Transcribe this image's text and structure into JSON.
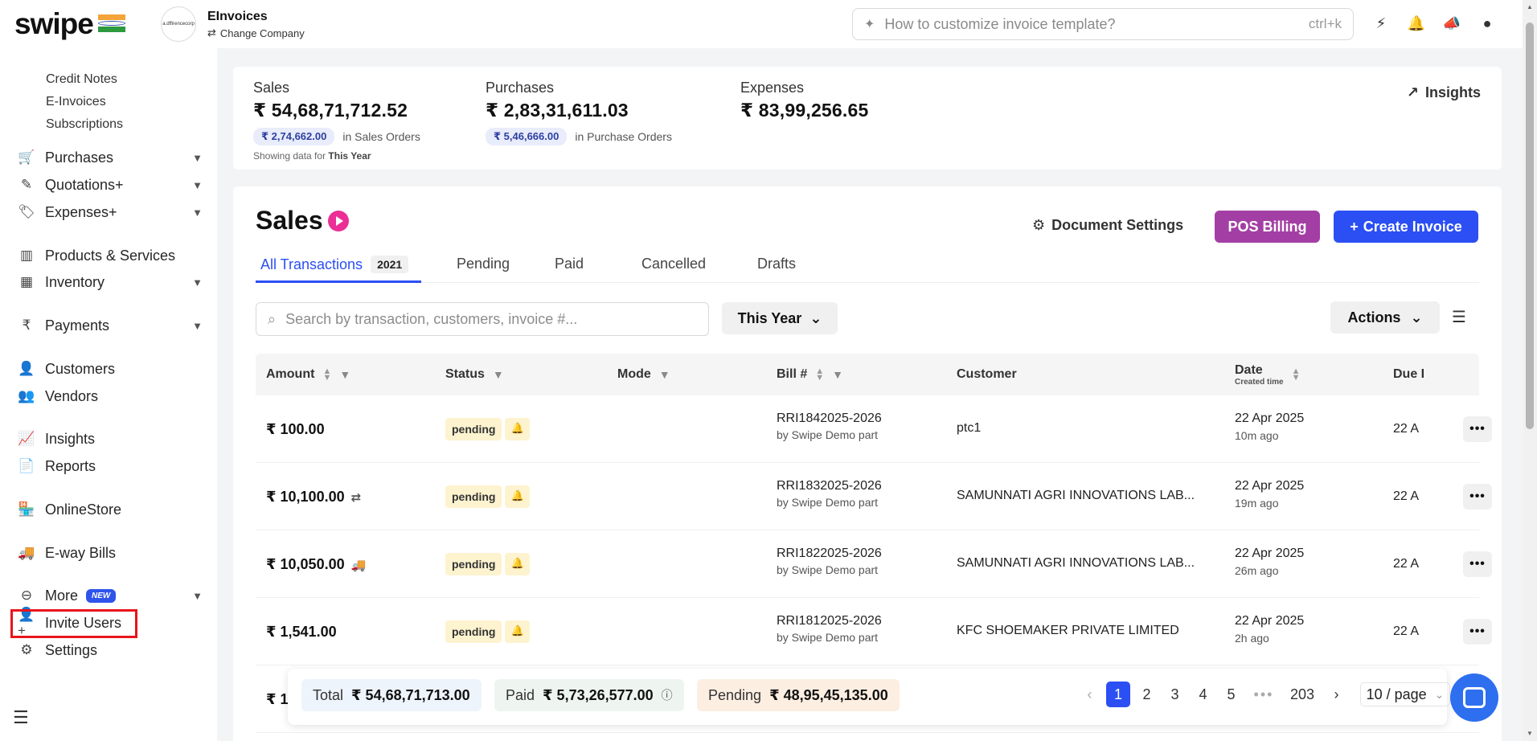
{
  "brand": {
    "logo_text": "swipe"
  },
  "company": {
    "avatar_text": "a.dffirencecorp",
    "name": "EInvoices",
    "change_label": "Change Company"
  },
  "topbar": {
    "search_placeholder": "How to customize invoice template?",
    "shortcut": "ctrl+k"
  },
  "sidebar": {
    "sub_items": [
      "Credit Notes",
      "E-Invoices",
      "Subscriptions"
    ],
    "items": {
      "purchases": "Purchases",
      "quotations": "Quotations+",
      "expenses": "Expenses+",
      "products": "Products & Services",
      "inventory": "Inventory",
      "payments": "Payments",
      "customers": "Customers",
      "vendors": "Vendors",
      "insights": "Insights",
      "reports": "Reports",
      "onlinestore": "OnlineStore",
      "ewaybills": "E-way Bills",
      "more": "More",
      "more_badge": "NEW",
      "invite": "Invite Users",
      "settings": "Settings"
    }
  },
  "stats": {
    "sales": {
      "label": "Sales",
      "value": "₹ 54,68,71,712.52",
      "pill": "₹ 2,74,662.00",
      "pill_note": "in Sales Orders"
    },
    "purchases": {
      "label": "Purchases",
      "value": "₹ 2,83,31,611.03",
      "pill": "₹ 5,46,666.00",
      "pill_note": "in Purchase Orders"
    },
    "expenses": {
      "label": "Expenses",
      "value": "₹ 83,99,256.65"
    },
    "showing_prefix": "Showing data for",
    "showing_period": "This Year",
    "insights_label": "Insights"
  },
  "page": {
    "title": "Sales",
    "doc_settings": "Document Settings",
    "pos_billing": "POS Billing",
    "create_invoice": "Create Invoice",
    "tabs": {
      "all": "All Transactions",
      "all_count": "2021",
      "pending": "Pending",
      "paid": "Paid",
      "cancelled": "Cancelled",
      "drafts": "Drafts"
    },
    "search_placeholder": "Search by transaction, customers, invoice #...",
    "period": "This Year",
    "actions": "Actions"
  },
  "table": {
    "headers": {
      "amount": "Amount",
      "status": "Status",
      "mode": "Mode",
      "bill": "Bill #",
      "customer": "Customer",
      "date": "Date",
      "date_sub": "Created time",
      "due": "Due I"
    },
    "rows": [
      {
        "amount": "₹ 100.00",
        "amount_icon": "",
        "status": "pending",
        "bill_no": "RRI1842025-2026",
        "bill_by": "by Swipe Demo part",
        "customer": "ptc1",
        "date": "22 Apr 2025",
        "ago": "10m ago",
        "due": "22 A"
      },
      {
        "amount": "₹ 10,100.00",
        "amount_icon": "⇄",
        "status": "pending",
        "bill_no": "RRI1832025-2026",
        "bill_by": "by Swipe Demo part",
        "customer": "SAMUNNATI AGRI INNOVATIONS LAB...",
        "date": "22 Apr 2025",
        "ago": "19m ago",
        "due": "22 A"
      },
      {
        "amount": "₹ 10,050.00",
        "amount_icon": "🚚",
        "status": "pending",
        "bill_no": "RRI1822025-2026",
        "bill_by": "by Swipe Demo part",
        "customer": "SAMUNNATI AGRI INNOVATIONS LAB...",
        "date": "22 Apr 2025",
        "ago": "26m ago",
        "due": "22 A"
      },
      {
        "amount": "₹ 1,541.00",
        "amount_icon": "",
        "status": "pending",
        "bill_no": "RRI1812025-2026",
        "bill_by": "by Swipe Demo part",
        "customer": "KFC SHOEMAKER PRIVATE LIMITED",
        "date": "22 Apr 2025",
        "ago": "2h ago",
        "due": "22 A"
      },
      {
        "amount": "₹ 1,",
        "amount_icon": "",
        "status": "",
        "bill_no": "",
        "bill_by": "",
        "customer": "",
        "date": "",
        "ago": "",
        "due": ""
      }
    ]
  },
  "summary": {
    "total_label": "Total",
    "total_value": "₹ 54,68,71,713.00",
    "paid_label": "Paid",
    "paid_value": "₹ 5,73,26,577.00",
    "pending_label": "Pending",
    "pending_value": "₹ 48,95,45,135.00"
  },
  "pagination": {
    "pages": [
      "1",
      "2",
      "3",
      "4",
      "5"
    ],
    "ellipsis": "•••",
    "last": "203",
    "page_size": "10 / page"
  },
  "colors": {
    "primary": "#2b4ff3",
    "pos": "#a33fa4",
    "pending_bg": "#fdf3cf",
    "highlight_box": "#e8141c"
  }
}
